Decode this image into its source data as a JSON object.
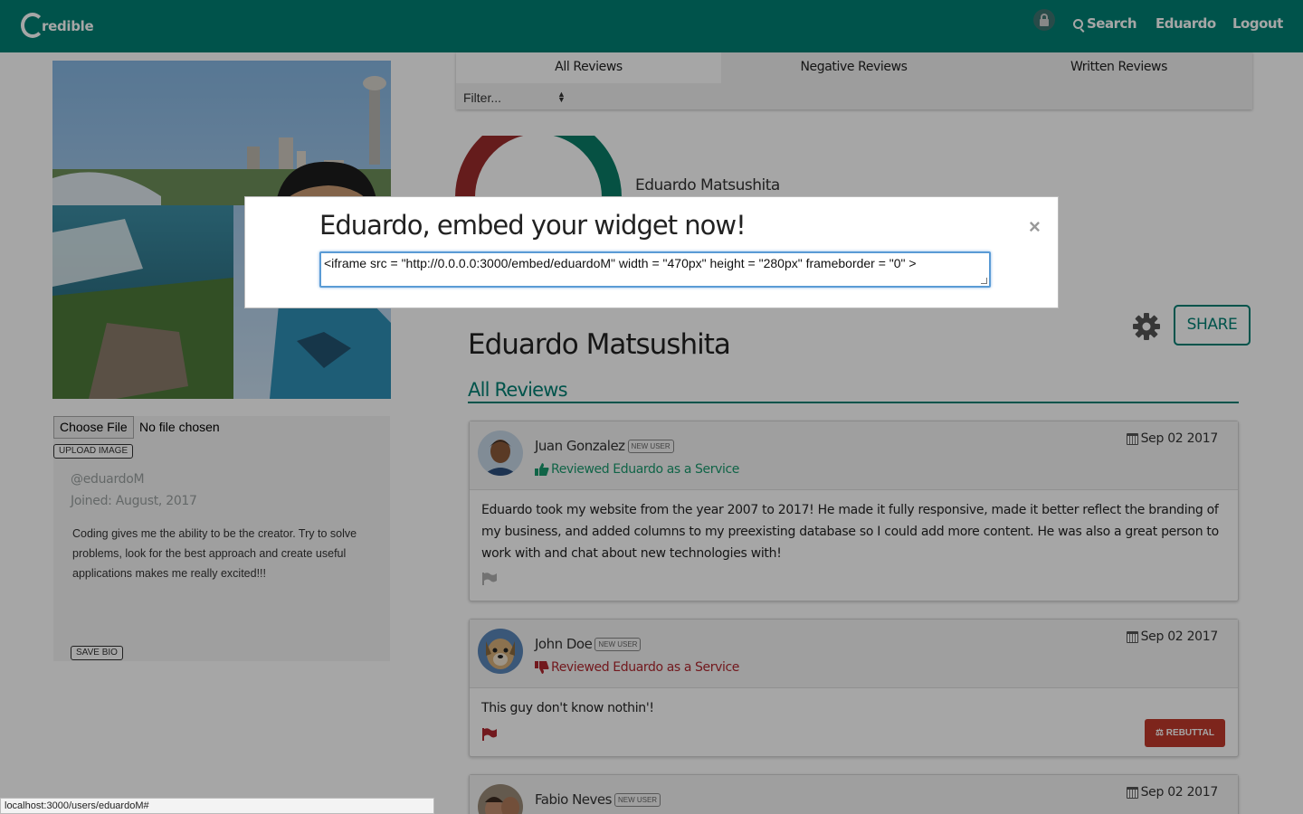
{
  "nav": {
    "brand_text": "redible",
    "search_label": "Search",
    "user_label": "Eduardo",
    "logout_label": "Logout"
  },
  "profile": {
    "choose_file_label": "Choose File",
    "no_file_text": "No file chosen",
    "upload_label": "UPLOAD IMAGE",
    "handle": "@eduardoM",
    "joined": "Joined: August, 2017",
    "bio": "Coding gives me the ability to be the creator. Try to solve problems, look for the best approach and create useful applications makes me really excited!!!",
    "save_bio_label": "SAVE BIO"
  },
  "tabs": [
    {
      "label": "All Reviews",
      "active": true
    },
    {
      "label": "Negative Reviews",
      "active": false
    },
    {
      "label": "Written Reviews",
      "active": false
    }
  ],
  "filter": {
    "placeholder": "Filter..."
  },
  "gauge": {
    "name": "Eduardo Matsushita",
    "positive_color": "#0a7d67",
    "negative_color": "#9b2b2b"
  },
  "main": {
    "name": "Eduardo Matsushita",
    "section_title": "All Reviews",
    "share_label": "SHARE"
  },
  "reviews": [
    {
      "name": "Juan Gonzalez",
      "badge": "NEW USER",
      "reviewed_text": "Reviewed Eduardo as a Service",
      "sentiment": "positive",
      "date": "Sep 02 2017",
      "body": "Eduardo took my website from the year 2007 to 2017! He made it fully responsive, made it better reflect the branding of my business, and added columns to my preexisting database so I could add more content. He was also a great person to work with and chat about new technologies with!"
    },
    {
      "name": "John Doe",
      "badge": "NEW USER",
      "reviewed_text": "Reviewed Eduardo as a Service",
      "sentiment": "negative",
      "date": "Sep 02 2017",
      "body": "This guy don't know nothin'!",
      "rebuttal_label": "REBUTTAL"
    },
    {
      "name": "Fabio Neves",
      "badge": "NEW USER",
      "date": "Sep 02 2017"
    }
  ],
  "modal": {
    "title": "Eduardo, embed your widget now!",
    "close": "×",
    "embed_code": "<iframe src = \"http://0.0.0.0:3000/embed/eduardoM\" width = \"470px\" height = \"280px\" frameborder = \"0\" >"
  },
  "statusbar": {
    "url": "localhost:3000/users/eduardoM#"
  },
  "colors": {
    "brand": "#008073",
    "negative": "#c0392b",
    "positive": "#1a9a6e"
  }
}
